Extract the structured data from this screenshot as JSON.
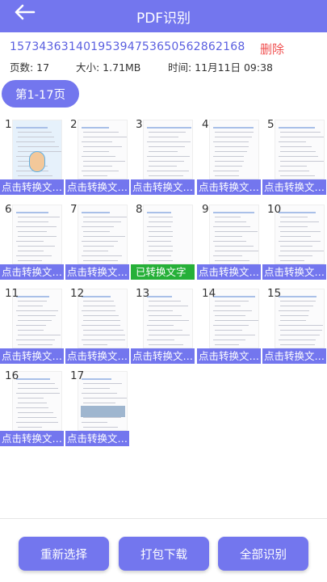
{
  "header": {
    "title": "PDF识别"
  },
  "file": {
    "name": "1573436314019539475365056286216",
    "name_tail": "8",
    "delete_label": "删除",
    "pages_text": "页数: 17",
    "size_text": "大小: 1.71MB",
    "time_text": "时间: 11月11日 09:38"
  },
  "range_label": "第1-17页",
  "pages": [
    {
      "n": "1",
      "label": "点击转换文…",
      "done": false
    },
    {
      "n": "2",
      "label": "点击转换文…",
      "done": false
    },
    {
      "n": "3",
      "label": "点击转换文…",
      "done": false
    },
    {
      "n": "4",
      "label": "点击转换文…",
      "done": false
    },
    {
      "n": "5",
      "label": "点击转换文…",
      "done": false
    },
    {
      "n": "6",
      "label": "点击转换文…",
      "done": false
    },
    {
      "n": "7",
      "label": "点击转换文…",
      "done": false
    },
    {
      "n": "8",
      "label": "已转换文字",
      "done": true
    },
    {
      "n": "9",
      "label": "点击转换文…",
      "done": false
    },
    {
      "n": "10",
      "label": "点击转换文…",
      "done": false
    },
    {
      "n": "11",
      "label": "点击转换文…",
      "done": false
    },
    {
      "n": "12",
      "label": "点击转换文…",
      "done": false
    },
    {
      "n": "13",
      "label": "点击转换文…",
      "done": false
    },
    {
      "n": "14",
      "label": "点击转换文…",
      "done": false
    },
    {
      "n": "15",
      "label": "点击转换文…",
      "done": false
    },
    {
      "n": "16",
      "label": "点击转换文…",
      "done": false
    },
    {
      "n": "17",
      "label": "点击转换文…",
      "done": false
    }
  ],
  "buttons": {
    "reselect": "重新选择",
    "package_download": "打包下载",
    "recognize_all": "全部识别"
  },
  "colors": {
    "accent": "#7376ee",
    "success": "#26b038",
    "danger": "#f05050"
  }
}
